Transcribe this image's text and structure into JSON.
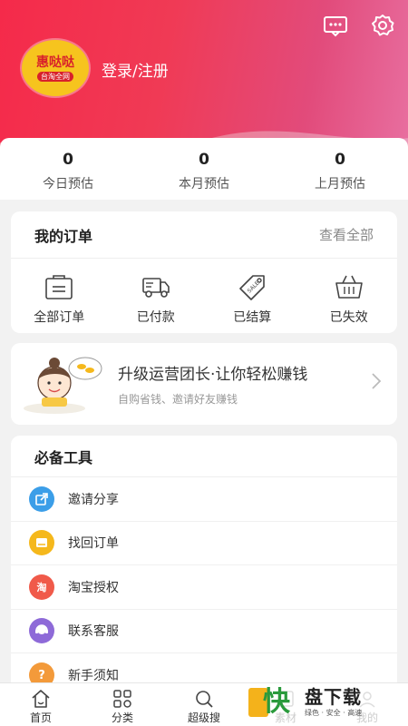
{
  "header": {
    "brand_name": "惠哒哒",
    "brand_sub": "台淘全网",
    "login_label": "登录/注册",
    "icons": [
      "message-icon",
      "settings-icon"
    ]
  },
  "stats": [
    {
      "value": "0",
      "label": "今日预估"
    },
    {
      "value": "0",
      "label": "本月预估"
    },
    {
      "value": "0",
      "label": "上月预估"
    }
  ],
  "orders": {
    "title": "我的订单",
    "view_all": "查看全部",
    "items": [
      {
        "label": "全部订单",
        "icon": "bag-icon"
      },
      {
        "label": "已付款",
        "icon": "truck-icon"
      },
      {
        "label": "已结算",
        "icon": "sale-tag-icon"
      },
      {
        "label": "已失效",
        "icon": "basket-icon"
      }
    ]
  },
  "promo": {
    "title": "升级运营团长·让你轻松赚钱",
    "subtitle": "自购省钱、邀请好友赚钱"
  },
  "tools": {
    "title": "必备工具",
    "items": [
      {
        "label": "邀请分享",
        "icon": "share-icon",
        "color": "#3b9ee8"
      },
      {
        "label": "找回订单",
        "icon": "order-icon",
        "color": "#f5b81c"
      },
      {
        "label": "淘宝授权",
        "icon": "taobao-icon",
        "color": "#f05a4a",
        "glyph": "淘"
      },
      {
        "label": "联系客服",
        "icon": "service-icon",
        "color": "#8e6ad8"
      },
      {
        "label": "新手须知",
        "icon": "help-icon",
        "color": "#f39a3a"
      }
    ]
  },
  "tabbar": [
    {
      "label": "首页",
      "icon": "home-icon"
    },
    {
      "label": "分类",
      "icon": "category-icon"
    },
    {
      "label": "超级搜",
      "icon": "search-icon"
    },
    {
      "label": "素材",
      "icon": "material-icon"
    },
    {
      "label": "我的",
      "icon": "profile-icon"
    }
  ],
  "watermark": {
    "logo": "快",
    "title": "盘下载",
    "tagline": "绿色 · 安全 · 高速"
  },
  "colors": {
    "header_red": "#f52a4a",
    "header_pink": "#e86fa0",
    "brand_yellow": "#f6c41e"
  }
}
